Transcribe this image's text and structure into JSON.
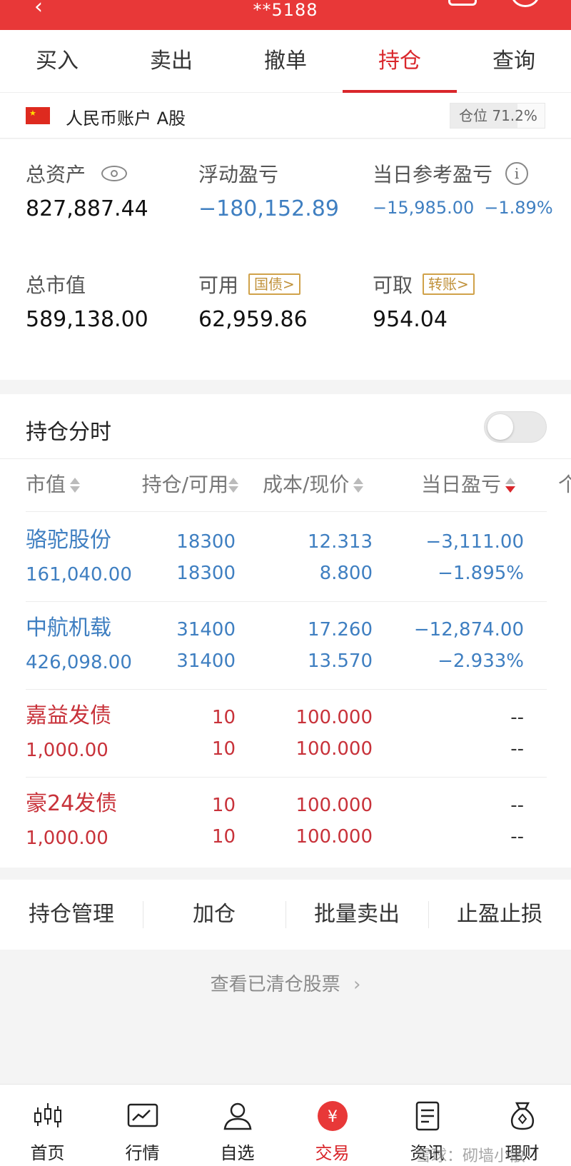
{
  "header": {
    "title": "**5188"
  },
  "tabs": [
    "买入",
    "卖出",
    "撤单",
    "持仓",
    "查询"
  ],
  "active_tab": "持仓",
  "account": {
    "label": "人民币账户 A股",
    "position_text": "仓位 71.2%",
    "position_ratio": 0.712
  },
  "summary": {
    "total_assets_label": "总资产",
    "total_assets": "827,887.44",
    "floating_pl_label": "浮动盈亏",
    "floating_pl": "−180,152.89",
    "daily_pl_label": "当日参考盈亏",
    "daily_pl": "−15,985.00",
    "daily_pl_pct": "−1.89%",
    "market_value_label": "总市值",
    "market_value": "589,138.00",
    "available_label": "可用",
    "available_tag": "国债>",
    "available": "62,959.86",
    "withdrawable_label": "可取",
    "withdrawable_tag": "转账>",
    "withdrawable": "954.04"
  },
  "holdings_section": {
    "title": "持仓分时",
    "toggle_on": false,
    "headers": [
      "市值",
      "持仓/可用",
      "成本/现价",
      "当日盈亏",
      "个"
    ],
    "rows": [
      {
        "name": "骆驼股份",
        "market_value": "161,040.00",
        "position": "18300",
        "available": "18300",
        "cost": "12.313",
        "price": "8.800",
        "pl": "−3,111.00",
        "pl_pct": "−1.895%",
        "color": "blue"
      },
      {
        "name": "中航机载",
        "market_value": "426,098.00",
        "position": "31400",
        "available": "31400",
        "cost": "17.260",
        "price": "13.570",
        "pl": "−12,874.00",
        "pl_pct": "−2.933%",
        "color": "blue"
      },
      {
        "name": "嘉益发债",
        "market_value": "1,000.00",
        "position": "10",
        "available": "10",
        "cost": "100.000",
        "price": "100.000",
        "pl": "--",
        "pl_pct": "--",
        "color": "red"
      },
      {
        "name": "豪24发债",
        "market_value": "1,000.00",
        "position": "10",
        "available": "10",
        "cost": "100.000",
        "price": "100.000",
        "pl": "--",
        "pl_pct": "--",
        "color": "red"
      }
    ]
  },
  "actions": [
    "持仓管理",
    "加仓",
    "批量卖出",
    "止盈止损"
  ],
  "cleared_link": "查看已清仓股票",
  "bottom_nav": [
    "首页",
    "行情",
    "自选",
    "交易",
    "资讯",
    "理财"
  ],
  "active_nav": "交易",
  "watermark": "雪球：砌墙小散",
  "colors": {
    "brand_red": "#e83838",
    "loss_blue": "#3f7fc1",
    "bond_red": "#c8323a",
    "tag_gold": "#c0913a"
  }
}
